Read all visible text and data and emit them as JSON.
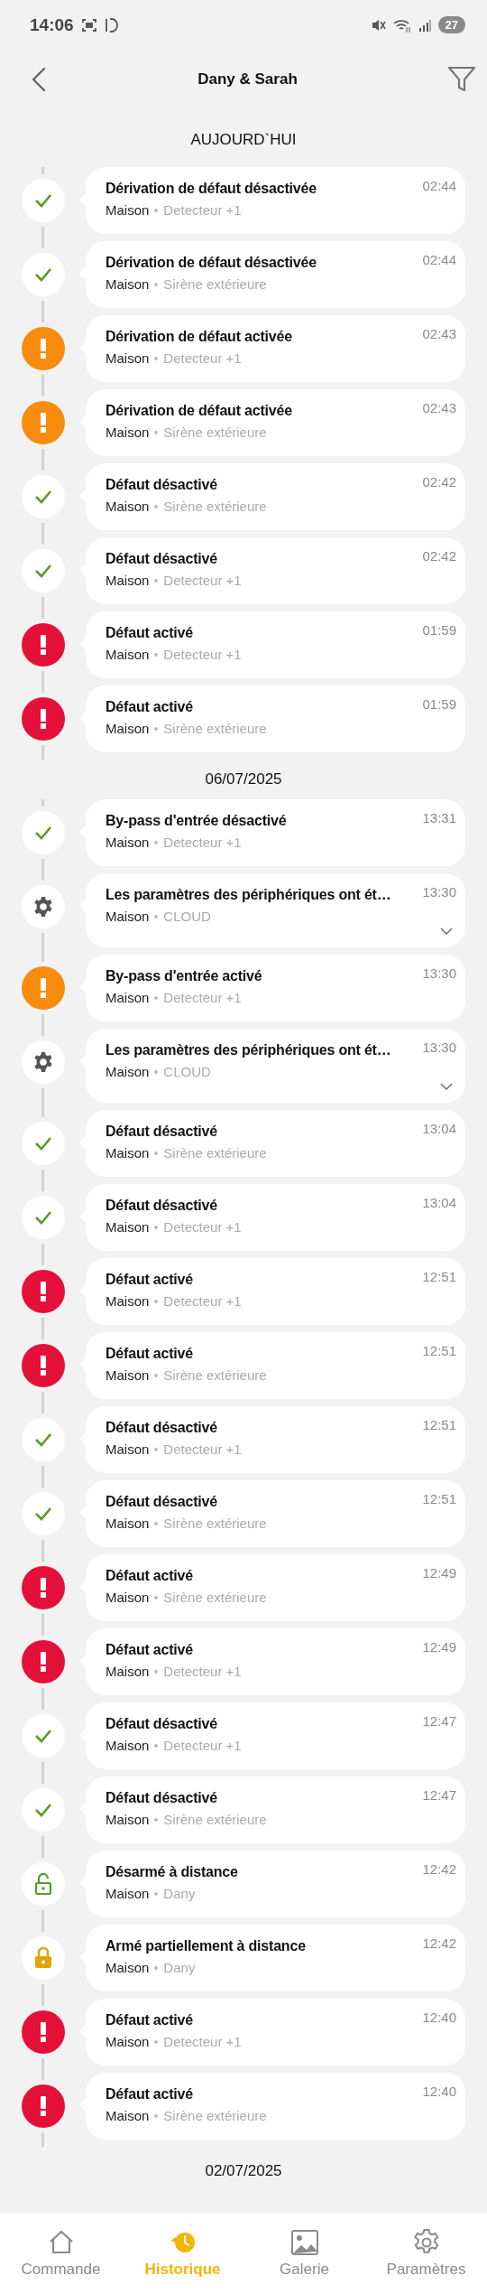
{
  "status_bar": {
    "time": "14:06",
    "battery": "27"
  },
  "header": {
    "title": "Dany & Sarah"
  },
  "sections": [
    {
      "date": "AUJOURD`HUI",
      "events": [
        {
          "kind": "ok",
          "title": "Dérivation de défaut désactivée",
          "place": "Maison",
          "source": "Detecteur +1",
          "time": "02:44",
          "expandable": false
        },
        {
          "kind": "ok",
          "title": "Dérivation de défaut désactivée",
          "place": "Maison",
          "source": "Sirène extérieure",
          "time": "02:44",
          "expandable": false
        },
        {
          "kind": "warning",
          "title": "Dérivation de défaut activée",
          "place": "Maison",
          "source": "Detecteur +1",
          "time": "02:43",
          "expandable": false
        },
        {
          "kind": "warning",
          "title": "Dérivation de défaut activée",
          "place": "Maison",
          "source": "Sirène extérieure",
          "time": "02:43",
          "expandable": false
        },
        {
          "kind": "ok",
          "title": "Défaut désactivé",
          "place": "Maison",
          "source": "Sirène extérieure",
          "time": "02:42",
          "expandable": false
        },
        {
          "kind": "ok",
          "title": "Défaut désactivé",
          "place": "Maison",
          "source": "Detecteur +1",
          "time": "02:42",
          "expandable": false
        },
        {
          "kind": "alarm",
          "title": "Défaut activé",
          "place": "Maison",
          "source": "Detecteur +1",
          "time": "01:59",
          "expandable": false
        },
        {
          "kind": "alarm",
          "title": "Défaut activé",
          "place": "Maison",
          "source": "Sirène extérieure",
          "time": "01:59",
          "expandable": false
        }
      ]
    },
    {
      "date": "06/07/2025",
      "events": [
        {
          "kind": "ok",
          "title": "By-pass d'entrée désactivé",
          "place": "Maison",
          "source": "Detecteur +1",
          "time": "13:31",
          "expandable": false
        },
        {
          "kind": "settings",
          "title": "Les paramètres des périphériques ont ét…",
          "place": "Maison",
          "source": "CLOUD",
          "time": "13:30",
          "expandable": true
        },
        {
          "kind": "warning",
          "title": "By-pass d'entrée activé",
          "place": "Maison",
          "source": "Detecteur +1",
          "time": "13:30",
          "expandable": false
        },
        {
          "kind": "settings",
          "title": "Les paramètres des périphériques ont ét…",
          "place": "Maison",
          "source": "CLOUD",
          "time": "13:30",
          "expandable": true
        },
        {
          "kind": "ok",
          "title": "Défaut désactivé",
          "place": "Maison",
          "source": "Sirène extérieure",
          "time": "13:04",
          "expandable": false
        },
        {
          "kind": "ok",
          "title": "Défaut désactivé",
          "place": "Maison",
          "source": "Detecteur +1",
          "time": "13:04",
          "expandable": false
        },
        {
          "kind": "alarm",
          "title": "Défaut activé",
          "place": "Maison",
          "source": "Detecteur +1",
          "time": "12:51",
          "expandable": false
        },
        {
          "kind": "alarm",
          "title": "Défaut activé",
          "place": "Maison",
          "source": "Sirène extérieure",
          "time": "12:51",
          "expandable": false
        },
        {
          "kind": "ok",
          "title": "Défaut désactivé",
          "place": "Maison",
          "source": "Detecteur +1",
          "time": "12:51",
          "expandable": false
        },
        {
          "kind": "ok",
          "title": "Défaut désactivé",
          "place": "Maison",
          "source": "Sirène extérieure",
          "time": "12:51",
          "expandable": false
        },
        {
          "kind": "alarm",
          "title": "Défaut activé",
          "place": "Maison",
          "source": "Sirène extérieure",
          "time": "12:49",
          "expandable": false
        },
        {
          "kind": "alarm",
          "title": "Défaut activé",
          "place": "Maison",
          "source": "Detecteur +1",
          "time": "12:49",
          "expandable": false
        },
        {
          "kind": "ok",
          "title": "Défaut désactivé",
          "place": "Maison",
          "source": "Detecteur +1",
          "time": "12:47",
          "expandable": false
        },
        {
          "kind": "ok",
          "title": "Défaut désactivé",
          "place": "Maison",
          "source": "Sirène extérieure",
          "time": "12:47",
          "expandable": false
        },
        {
          "kind": "disarmed",
          "title": "Désarmé à distance",
          "place": "Maison",
          "source": "Dany",
          "time": "12:42",
          "expandable": false
        },
        {
          "kind": "armed",
          "title": "Armé partiellement à distance",
          "place": "Maison",
          "source": "Dany",
          "time": "12:42",
          "expandable": false
        },
        {
          "kind": "alarm",
          "title": "Défaut activé",
          "place": "Maison",
          "source": "Detecteur +1",
          "time": "12:40",
          "expandable": false
        },
        {
          "kind": "alarm",
          "title": "Défaut activé",
          "place": "Maison",
          "source": "Sirène extérieure",
          "time": "12:40",
          "expandable": false
        }
      ]
    },
    {
      "date": "02/07/2025"
    }
  ],
  "nav": [
    {
      "kind": "home",
      "label": "Commande",
      "selected": false
    },
    {
      "kind": "history",
      "label": "Historique",
      "selected": true
    },
    {
      "kind": "gallery",
      "label": "Galerie",
      "selected": false
    },
    {
      "kind": "settings",
      "label": "Paramètres",
      "selected": false
    }
  ]
}
